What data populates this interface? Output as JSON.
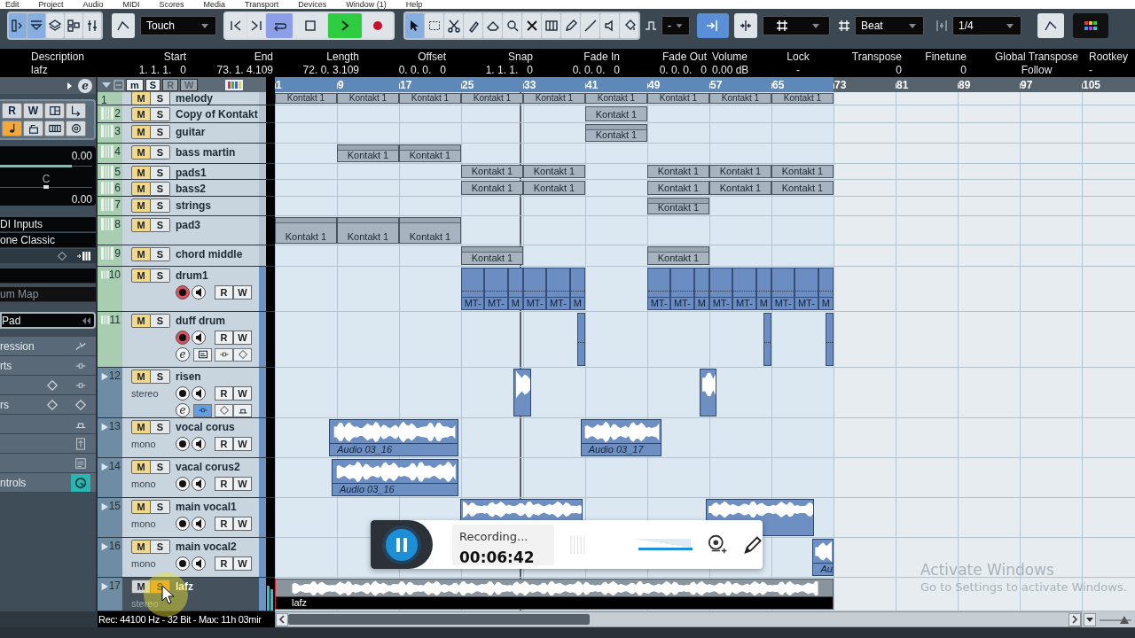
{
  "menu": [
    "Edit",
    "Project",
    "Audio",
    "MIDI",
    "Scores",
    "Media",
    "Transport",
    "Devices",
    "Window (1)",
    "Help"
  ],
  "toolbar": {
    "view_buttons": [
      {
        "kind": "panel",
        "selected": true
      },
      {
        "kind": "infoline",
        "selected": true
      },
      {
        "kind": "overview",
        "selected": false
      },
      {
        "kind": "pool",
        "selected": false
      },
      {
        "kind": "mixer",
        "selected": false
      }
    ],
    "automation_mode": "Touch",
    "transport": [
      {
        "kind": "prev",
        "on": false
      },
      {
        "kind": "next",
        "on": false
      },
      {
        "kind": "cycle",
        "on": true
      },
      {
        "kind": "stop",
        "on": false
      },
      {
        "kind": "play",
        "on": true
      },
      {
        "kind": "record",
        "on": false
      }
    ],
    "tools": [
      {
        "kind": "object",
        "selected": true
      },
      {
        "kind": "range",
        "selected": false
      },
      {
        "kind": "split",
        "selected": false
      },
      {
        "kind": "glue",
        "selected": false
      },
      {
        "kind": "erase",
        "selected": false
      },
      {
        "kind": "zoom",
        "selected": false
      },
      {
        "kind": "mute",
        "selected": false
      },
      {
        "kind": "comp",
        "selected": false
      },
      {
        "kind": "draw",
        "selected": false
      },
      {
        "kind": "line",
        "selected": false
      },
      {
        "kind": "audition",
        "selected": false
      },
      {
        "kind": "color",
        "selected": false
      }
    ],
    "nudge": "-",
    "snap_on": true,
    "grid_type": "Beat",
    "quantize": "1/4"
  },
  "info_line": [
    {
      "label": "Description",
      "value": "lafz"
    },
    {
      "label": "Start",
      "value": "1. 1. 1.   0"
    },
    {
      "label": "End",
      "value": "73. 1. 4.109"
    },
    {
      "label": "Length",
      "value": "72. 0. 3.109"
    },
    {
      "label": "Offset",
      "value": "0. 0. 0.   0"
    },
    {
      "label": "Snap",
      "value": "1. 1. 1.   0"
    },
    {
      "label": "Fade In",
      "value": "0. 0. 0.   0"
    },
    {
      "label": "Fade Out",
      "value": "0. 0. 0.   0"
    },
    {
      "label": "Volume",
      "value": "0.00 dB"
    },
    {
      "label": "Lock",
      "value": "-"
    },
    {
      "label": "Transpose",
      "value": "0"
    },
    {
      "label": "Finetune",
      "value": "0"
    },
    {
      "label": "Global Transpose",
      "value": "Follow"
    },
    {
      "label": "Rootkey",
      "value": "-"
    }
  ],
  "inspector": {
    "edit_label": "e",
    "button_rows": [
      [
        {
          "kind": "read",
          "label": "R",
          "on": false
        },
        {
          "kind": "write",
          "label": "W",
          "on": false
        },
        {
          "kind": "layout",
          "on": false
        },
        {
          "kind": "output",
          "on": false
        }
      ],
      [
        {
          "kind": "note",
          "on": true
        },
        {
          "kind": "lock",
          "on": false
        },
        {
          "kind": "keys",
          "on": false
        },
        {
          "kind": "gear",
          "on": false
        }
      ]
    ],
    "volume": {
      "value": "0.00",
      "level": 0.78
    },
    "pan": {
      "value": "C",
      "level": 0.5
    },
    "delay": {
      "value": "0.00"
    },
    "fields": [
      {
        "kind": "field",
        "text": "DI Inputs"
      },
      {
        "kind": "field",
        "text": "one Classic"
      },
      {
        "kind": "tools"
      },
      {
        "kind": "field"
      },
      {
        "kind": "dim",
        "text": "um Map"
      },
      {
        "kind": "focus",
        "text": "Pad"
      }
    ],
    "sections": [
      {
        "label": "ression",
        "icons": [
          {
            "kind": "expression"
          }
        ],
        "selected": false
      },
      {
        "label": "rts",
        "icons": [
          {
            "kind": "insert"
          }
        ],
        "selected": false
      },
      {
        "icons": [
          {
            "kind": "diamond"
          },
          {
            "kind": "insert"
          }
        ],
        "selected": false
      },
      {
        "label": "rs",
        "icons": [
          {
            "kind": "diamond"
          },
          {
            "kind": "diamond"
          }
        ],
        "selected": false
      },
      {
        "icons": [
          {
            "kind": "sends"
          }
        ],
        "selected": false
      },
      {
        "icons": [
          {
            "kind": "upload"
          }
        ],
        "selected": false
      },
      {
        "icons": [
          {
            "kind": "notepad"
          }
        ],
        "selected": false
      },
      {
        "label": "ntrols",
        "icons": [
          {
            "kind": "knob"
          }
        ],
        "selected": true
      }
    ]
  },
  "track_header": [
    {
      "label": "m",
      "disabled": false
    },
    {
      "label": "S",
      "disabled": false
    },
    {
      "label": "R",
      "disabled": true
    },
    {
      "label": "W",
      "disabled": true
    }
  ],
  "ruler": {
    "labels": [
      "1",
      "9",
      "17",
      "25",
      "33",
      "41",
      "49",
      "57",
      "65",
      "73",
      "81",
      "89",
      "97",
      "105"
    ]
  },
  "tracks": [
    {
      "number": "1",
      "name": "melody",
      "kind": "instrument",
      "selected": false,
      "mute": {
        "label": "M",
        "on": true
      },
      "solo": {
        "label": "S",
        "on": false
      },
      "parts": [
        {
          "kind": "midi",
          "name": "Kontakt 1",
          "selected": false
        },
        {
          "kind": "midi",
          "name": "Kontakt 1",
          "selected": false
        },
        {
          "kind": "midi",
          "name": "Kontakt 1",
          "selected": false
        },
        {
          "kind": "midi",
          "name": "Kontakt 1",
          "selected": false
        },
        {
          "kind": "midi",
          "name": "Kontakt 1",
          "selected": false
        },
        {
          "kind": "midi",
          "name": "Kontakt 1",
          "selected": false
        },
        {
          "kind": "midi",
          "name": "Kontakt 1",
          "selected": false
        },
        {
          "kind": "midi",
          "name": "Kontakt 1",
          "selected": false
        },
        {
          "kind": "midi",
          "name": "Kontakt 1",
          "selected": false
        }
      ]
    },
    {
      "number": "2",
      "name": "Copy of Kontakt",
      "kind": "instrument",
      "selected": false,
      "mute": {
        "label": "M",
        "on": true
      },
      "solo": {
        "label": "S",
        "on": false
      },
      "parts": [
        {
          "kind": "midi",
          "name": "Kontakt 1",
          "selected": false
        }
      ]
    },
    {
      "number": "3",
      "name": "guitar",
      "kind": "instrument",
      "selected": false,
      "mute": {
        "label": "M",
        "on": true
      },
      "solo": {
        "label": "S",
        "on": false
      },
      "parts": [
        {
          "kind": "midi",
          "name": "Kontakt 1",
          "selected": false
        }
      ]
    },
    {
      "number": "4",
      "name": "bass martin",
      "kind": "instrument",
      "selected": false,
      "mute": {
        "label": "M",
        "on": true
      },
      "solo": {
        "label": "S",
        "on": false
      },
      "parts": [
        {
          "kind": "midi",
          "name": "Kontakt 1",
          "selected": false
        },
        {
          "kind": "midi",
          "name": "Kontakt 1",
          "selected": false
        }
      ]
    },
    {
      "number": "5",
      "name": "pads1",
      "kind": "instrument",
      "selected": false,
      "mute": {
        "label": "M",
        "on": true
      },
      "solo": {
        "label": "S",
        "on": false
      },
      "parts": [
        {
          "kind": "midi",
          "name": "Kontakt 1",
          "selected": false
        },
        {
          "kind": "midi",
          "name": "Kontakt 1",
          "selected": false
        },
        {
          "kind": "midi",
          "name": "Kontakt 1",
          "selected": false
        },
        {
          "kind": "midi",
          "name": "Kontakt 1",
          "selected": false
        },
        {
          "kind": "midi",
          "name": "Kontakt 1",
          "selected": false
        }
      ]
    },
    {
      "number": "6",
      "name": "bass2",
      "kind": "instrument",
      "selected": false,
      "mute": {
        "label": "M",
        "on": true
      },
      "solo": {
        "label": "S",
        "on": false
      },
      "parts": [
        {
          "kind": "midi",
          "name": "Kontakt 1",
          "selected": false
        },
        {
          "kind": "midi",
          "name": "Kontakt 1",
          "selected": false
        },
        {
          "kind": "midi",
          "name": "Kontakt 1",
          "selected": false
        },
        {
          "kind": "midi",
          "name": "Kontakt 1",
          "selected": false
        },
        {
          "kind": "midi",
          "name": "Kontakt 1",
          "selected": false
        }
      ]
    },
    {
      "number": "7",
      "name": "strings",
      "kind": "instrument",
      "selected": false,
      "mute": {
        "label": "M",
        "on": true
      },
      "solo": {
        "label": "S",
        "on": false
      },
      "parts": [
        {
          "kind": "midi",
          "name": "Kontakt 1",
          "selected": false
        }
      ]
    },
    {
      "number": "8",
      "name": "pad3",
      "kind": "instrument",
      "selected": false,
      "mute": {
        "label": "M",
        "on": true
      },
      "solo": {
        "label": "S",
        "on": false
      },
      "parts": [
        {
          "kind": "midi",
          "name": "Kontakt 1",
          "selected": false
        },
        {
          "kind": "midi",
          "name": "Kontakt 1",
          "selected": false
        },
        {
          "kind": "midi",
          "name": "Kontakt 1",
          "selected": false
        }
      ]
    },
    {
      "number": "9",
      "name": "chord middle",
      "kind": "instrument",
      "selected": false,
      "mute": {
        "label": "M",
        "on": true
      },
      "solo": {
        "label": "S",
        "on": false
      },
      "parts": [
        {
          "kind": "midi",
          "name": "Kontakt 1",
          "selected": false
        },
        {
          "kind": "midi",
          "name": "Kontakt 1",
          "selected": false
        }
      ]
    },
    {
      "number": "10",
      "name": "drum1",
      "kind": "midi",
      "selected": false,
      "mute": {
        "label": "M",
        "on": true
      },
      "solo": {
        "label": "S",
        "on": false
      },
      "controls": [
        {
          "kind": "record",
          "on": true
        },
        {
          "kind": "monitor",
          "on": false
        },
        {
          "kind": "read",
          "label": "R",
          "on": false
        },
        {
          "kind": "write",
          "label": "W",
          "on": false
        }
      ],
      "parts": [
        {
          "kind": "drum",
          "name": "MT-",
          "selected": false
        },
        {
          "kind": "drum",
          "name": "MT-",
          "selected": false
        },
        {
          "kind": "drum",
          "name": "M",
          "selected": false
        },
        {
          "kind": "drum",
          "name": "MT-",
          "selected": false
        },
        {
          "kind": "drum",
          "name": "MT-",
          "selected": false
        },
        {
          "kind": "drum",
          "name": "M",
          "selected": false
        },
        {
          "kind": "drum",
          "name": "MT-",
          "selected": false
        },
        {
          "kind": "drum",
          "name": "MT-",
          "selected": false
        },
        {
          "kind": "drum",
          "name": "M",
          "selected": false
        },
        {
          "kind": "drum",
          "name": "MT-",
          "selected": false
        },
        {
          "kind": "drum",
          "name": "MT-",
          "selected": false
        },
        {
          "kind": "drum",
          "name": "M",
          "selected": false
        },
        {
          "kind": "drum",
          "name": "MT-",
          "selected": false
        },
        {
          "kind": "drum",
          "name": "MT-",
          "selected": false
        },
        {
          "kind": "drum",
          "name": "M",
          "selected": false
        }
      ]
    },
    {
      "number": "11",
      "name": "duff drum",
      "kind": "midi",
      "selected": false,
      "mute": {
        "label": "M",
        "on": true
      },
      "solo": {
        "label": "S",
        "on": false
      },
      "controls": [
        {
          "kind": "record",
          "on": true
        },
        {
          "kind": "monitor",
          "on": false
        },
        {
          "kind": "read",
          "label": "R",
          "on": false
        },
        {
          "kind": "write",
          "label": "W",
          "on": false
        }
      ],
      "extras": [
        {
          "kind": "edit",
          "label": "e",
          "on": false
        },
        {
          "kind": "lanes",
          "on": false
        },
        {
          "kind": "insert",
          "on": false
        },
        {
          "kind": "diamond",
          "on": false
        }
      ],
      "parts": [
        {
          "kind": "drum",
          "selected": false
        },
        {
          "kind": "drum",
          "selected": false
        },
        {
          "kind": "drum",
          "selected": false
        }
      ]
    },
    {
      "number": "12",
      "name": "risen",
      "kind": "audio",
      "channel": "stereo",
      "selected": false,
      "mute": {
        "label": "M",
        "on": true
      },
      "solo": {
        "label": "S",
        "on": false
      },
      "controls": [
        {
          "kind": "record",
          "on": false
        },
        {
          "kind": "monitor",
          "on": false
        },
        {
          "kind": "read",
          "label": "R",
          "on": false
        },
        {
          "kind": "write",
          "label": "W",
          "on": false
        }
      ],
      "extras": [
        {
          "kind": "edit",
          "label": "e",
          "on": false
        },
        {
          "kind": "insert",
          "on": true
        },
        {
          "kind": "diamond",
          "on": false
        },
        {
          "kind": "bypass",
          "on": false
        }
      ],
      "parts": [
        {
          "kind": "audio",
          "selected": false
        },
        {
          "kind": "audio",
          "selected": false
        }
      ]
    },
    {
      "number": "13",
      "name": "vocal corus",
      "kind": "audio",
      "channel": "mono",
      "selected": false,
      "mute": {
        "label": "M",
        "on": true
      },
      "solo": {
        "label": "S",
        "on": false
      },
      "controls": [
        {
          "kind": "record",
          "on": false
        },
        {
          "kind": "monitor",
          "on": false
        },
        {
          "kind": "read",
          "label": "R",
          "on": false
        },
        {
          "kind": "write",
          "label": "W",
          "on": false
        }
      ],
      "parts": [
        {
          "kind": "audio",
          "name": "Audio 03_16",
          "selected": false
        },
        {
          "kind": "audio",
          "name": "Audio 03_17",
          "selected": false
        }
      ]
    },
    {
      "number": "14",
      "name": "vacal corus2",
      "kind": "audio",
      "channel": "mono",
      "selected": false,
      "mute": {
        "label": "M",
        "on": true
      },
      "solo": {
        "label": "S",
        "on": false
      },
      "controls": [
        {
          "kind": "record",
          "on": false
        },
        {
          "kind": "monitor",
          "on": false
        },
        {
          "kind": "read",
          "label": "R",
          "on": false
        },
        {
          "kind": "write",
          "label": "W",
          "on": false
        }
      ],
      "parts": [
        {
          "kind": "audio",
          "name": "Audio 03_16",
          "selected": false
        }
      ]
    },
    {
      "number": "15",
      "name": "main vocal1",
      "kind": "audio",
      "channel": "mono",
      "selected": false,
      "mute": {
        "label": "M",
        "on": true
      },
      "solo": {
        "label": "S",
        "on": false
      },
      "controls": [
        {
          "kind": "record",
          "on": false
        },
        {
          "kind": "monitor",
          "on": false
        },
        {
          "kind": "read",
          "label": "R",
          "on": false
        },
        {
          "kind": "write",
          "label": "W",
          "on": false
        }
      ],
      "parts": [
        {
          "kind": "audio",
          "selected": false
        },
        {
          "kind": "audio",
          "selected": false
        }
      ]
    },
    {
      "number": "16",
      "name": "main vocal2",
      "kind": "audio",
      "channel": "mono",
      "selected": false,
      "mute": {
        "label": "M",
        "on": true
      },
      "solo": {
        "label": "S",
        "on": false
      },
      "controls": [
        {
          "kind": "record",
          "on": false
        },
        {
          "kind": "monitor",
          "on": false
        },
        {
          "kind": "read",
          "label": "R",
          "on": false
        },
        {
          "kind": "write",
          "label": "W",
          "on": false
        }
      ],
      "parts": [
        {
          "kind": "audio",
          "name": "Au",
          "selected": false
        }
      ]
    },
    {
      "number": "17",
      "name": "lafz",
      "kind": "audio",
      "channel": "stereo",
      "selected": true,
      "mute": {
        "label": "M",
        "on": false
      },
      "solo": {
        "label": "S",
        "on": true
      },
      "meter": {
        "level": 0.75
      },
      "parts": [
        {
          "kind": "audio",
          "name": "lafz",
          "selected": true
        }
      ]
    }
  ],
  "status": {
    "text": "Rec: 44100 Hz - 32 Bit - Max: 11h 03mir"
  },
  "recorder": {
    "recording": true,
    "status": "Recording...",
    "time": "00:06:42",
    "volume": {
      "level": 1
    }
  },
  "os_notice": {
    "title": "Activate Windows",
    "subtitle": "Go to Settings to activate Windows."
  }
}
